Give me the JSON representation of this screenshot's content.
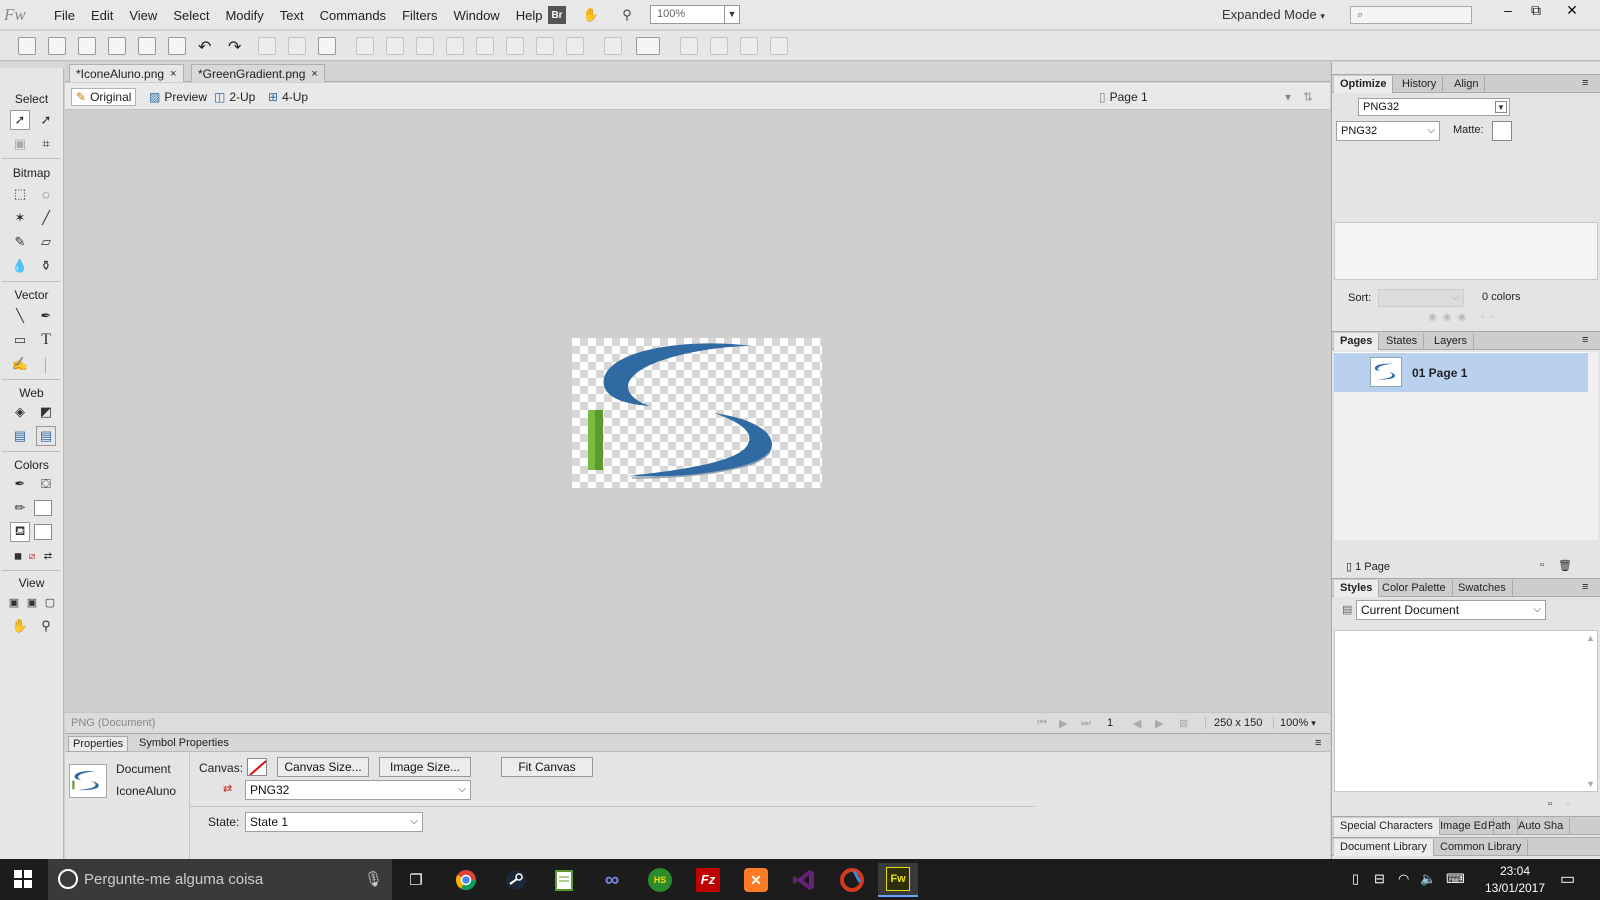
{
  "app": {
    "logo": "Fw"
  },
  "menubar": {
    "items": [
      "File",
      "Edit",
      "View",
      "Select",
      "Modify",
      "Text",
      "Commands",
      "Filters",
      "Window",
      "Help"
    ],
    "bridge_label": "Br",
    "zoom_value": "100%",
    "mode_label": "Expanded Mode",
    "search_placeholder": ""
  },
  "document_tabs": [
    {
      "label": "*IconeAluno.png",
      "close": "×"
    },
    {
      "label": "*GreenGradient.png",
      "close": "×"
    }
  ],
  "view_modes": {
    "original": "Original",
    "preview": "Preview",
    "two_up": "2-Up",
    "four_up": "4-Up",
    "page": "Page 1"
  },
  "tools": {
    "sections": [
      "Select",
      "Bitmap",
      "Vector",
      "Web",
      "Colors",
      "View"
    ]
  },
  "status": {
    "doc_type": "PNG (Document)",
    "frame": "1",
    "size": "250 x 150",
    "zoom": "100%"
  },
  "properties": {
    "tabs": [
      "Properties",
      "Symbol Properties"
    ],
    "doc_label": "Document",
    "doc_name": "IconeAluno",
    "canvas_label": "Canvas:",
    "canvas_size_btn": "Canvas Size...",
    "image_size_btn": "Image Size...",
    "fit_canvas_btn": "Fit Canvas",
    "format_value": "PNG32",
    "state_label": "State:",
    "state_value": "State 1"
  },
  "optimize_panel": {
    "tabs": [
      "Optimize",
      "History",
      "Align"
    ],
    "preset": "PNG32",
    "format": "PNG32",
    "matte_label": "Matte:",
    "sort_label": "Sort:",
    "colors_count": "0 colors"
  },
  "pages_panel": {
    "tabs": [
      "Pages",
      "States",
      "Layers"
    ],
    "page_item": "01  Page 1",
    "count": "1 Page"
  },
  "styles_panel": {
    "tabs": [
      "Styles",
      "Color Palette",
      "Swatches"
    ],
    "source": "Current Document"
  },
  "bottom_tabs_1": [
    "Special Characters",
    "Image Ed",
    "Path",
    "Auto Sha"
  ],
  "bottom_tabs_2": [
    "Document Library",
    "Common Library"
  ],
  "taskbar": {
    "search_placeholder": "Pergunte-me alguma coisa",
    "time": "23:04",
    "date": "13/01/2017",
    "apps": [
      "HS",
      "Fz",
      "Fw"
    ]
  },
  "colors": {
    "accent": "#2f6aa3",
    "green": "#5a9a2e",
    "selected": "#b9d1ee"
  }
}
